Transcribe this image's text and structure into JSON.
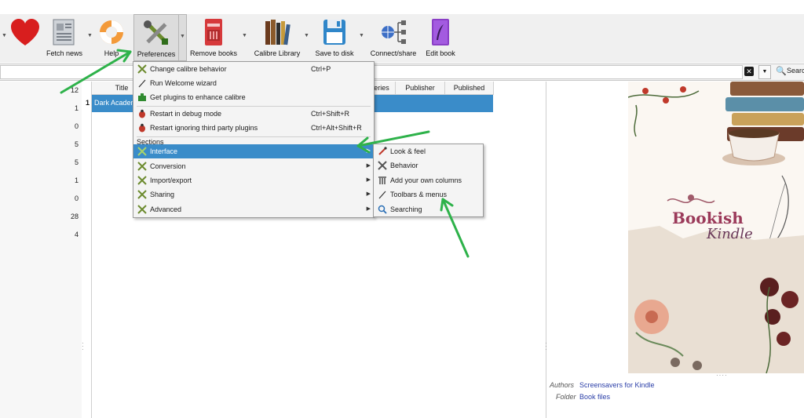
{
  "toolbar": {
    "buttons": [
      {
        "name": "fetch-news-button",
        "label": "Fetch news",
        "icon": "newspaper-icon"
      },
      {
        "name": "help-button",
        "label": "Help",
        "icon": "lifebuoy-icon"
      },
      {
        "name": "preferences-button",
        "label": "Preferences",
        "icon": "tools-icon"
      },
      {
        "name": "remove-books-button",
        "label": "Remove books",
        "icon": "trash-icon"
      },
      {
        "name": "calibre-library-button",
        "label": "Calibre Library",
        "icon": "books-icon"
      },
      {
        "name": "save-to-disk-button",
        "label": "Save to disk",
        "icon": "floppy-icon"
      },
      {
        "name": "connect-share-button",
        "label": "Connect/share",
        "icon": "network-icon"
      },
      {
        "name": "edit-book-button",
        "label": "Edit book",
        "icon": "purple-book-icon"
      }
    ]
  },
  "search": {
    "label": "Searc"
  },
  "counts": [
    "12",
    "1",
    "0",
    "5",
    "5",
    "1",
    "0",
    "28",
    "4"
  ],
  "table": {
    "headers": [
      "Title",
      "eries",
      "Publisher",
      "Published"
    ],
    "row_num": "1",
    "row_title": "Dark Acaden"
  },
  "prefs_menu": {
    "items": [
      {
        "label": "Change calibre behavior",
        "shortcut": "Ctrl+P",
        "icon": "tools-icon"
      },
      {
        "label": "Run Welcome wizard",
        "shortcut": "",
        "icon": "wand-icon"
      },
      {
        "label": "Get plugins to enhance calibre",
        "shortcut": "",
        "icon": "plugin-icon"
      },
      {
        "label": "Restart in debug mode",
        "shortcut": "Ctrl+Shift+R",
        "icon": "bug-icon"
      },
      {
        "label": "Restart ignoring third party plugins",
        "shortcut": "Ctrl+Alt+Shift+R",
        "icon": "bug-icon"
      }
    ],
    "section_label": "Sections",
    "sections": [
      {
        "label": "Interface",
        "selected": true
      },
      {
        "label": "Conversion",
        "selected": false
      },
      {
        "label": "Import/export",
        "selected": false
      },
      {
        "label": "Sharing",
        "selected": false
      },
      {
        "label": "Advanced",
        "selected": false
      }
    ]
  },
  "interface_submenu": {
    "items": [
      {
        "label": "Look & feel",
        "icon": "brush-icon"
      },
      {
        "label": "Behavior",
        "icon": "tools-icon"
      },
      {
        "label": "Add your own columns",
        "icon": "columns-icon"
      },
      {
        "label": "Toolbars & menus",
        "icon": "wand-icon"
      },
      {
        "label": "Searching",
        "icon": "magnifier-icon"
      }
    ]
  },
  "cover": {
    "line1": "Bookish",
    "line2": "Kindle"
  },
  "details": {
    "authors_key": "Authors",
    "authors_val": "Screensavers for Kindle",
    "folder_key": "Folder",
    "folder_val": "Book files"
  },
  "colors": {
    "accent": "#3a8cc9",
    "arrow": "#2eb24a",
    "link": "#2b3fa8"
  }
}
